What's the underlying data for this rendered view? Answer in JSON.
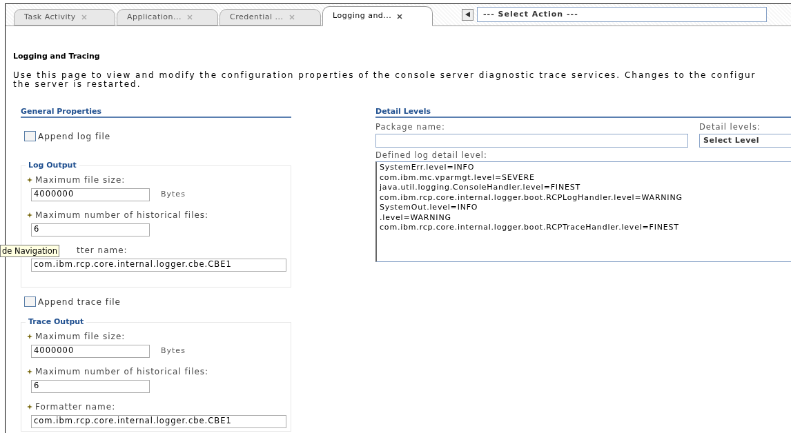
{
  "tabs": [
    {
      "label": "Task Activity",
      "selected": false
    },
    {
      "label": "Application...",
      "selected": false
    },
    {
      "label": "Credential ...",
      "selected": false
    },
    {
      "label": "Logging and...",
      "selected": true
    }
  ],
  "action_select": {
    "value": "--- Select Action ---"
  },
  "page_title": "Logging and Tracing",
  "description_lines": [
    "Use this page to view and modify the configuration properties of the console server diagnostic trace services. Changes to the configur",
    "the server is restarted."
  ],
  "general_properties": {
    "heading": "General Properties",
    "groups": [
      {
        "checkbox": {
          "label": "Append log file",
          "checked": false
        },
        "legend": "Log Output",
        "fields": [
          {
            "label": "Maximum file size:",
            "required": true,
            "value": "4000000",
            "unit": "Bytes"
          },
          {
            "label": "Maximum number of historical files:",
            "required": true,
            "value": "6"
          },
          {
            "label": "tter name:",
            "value": "com.ibm.rcp.core.internal.logger.cbe.CBE1"
          }
        ]
      },
      {
        "checkbox": {
          "label": "Append trace file",
          "checked": false
        },
        "legend": "Trace Output",
        "fields": [
          {
            "label": "Maximum file size:",
            "required": true,
            "value": "4000000",
            "unit": "Bytes"
          },
          {
            "label": "Maximum number of historical files:",
            "required": true,
            "value": "6"
          },
          {
            "label": "Formatter name:",
            "required": true,
            "value": "com.ibm.rcp.core.internal.logger.cbe.CBE1"
          }
        ]
      }
    ]
  },
  "detail_levels": {
    "heading": "Detail Levels",
    "package_name": {
      "label": "Package name:"
    },
    "level_select": {
      "label": "Detail levels:",
      "value": "Select Level"
    },
    "defined": {
      "label": "Defined log detail level:",
      "lines": [
        "SystemErr.level=INFO",
        "com.ibm.mc.vparmgt.level=SEVERE",
        "java.util.logging.ConsoleHandler.level=FINEST",
        "com.ibm.rcp.core.internal.logger.boot.RCPLogHandler.level=WARNING",
        "SystemOut.level=INFO",
        ".level=WARNING",
        "com.ibm.rcp.core.internal.logger.boot.RCPTraceHandler.level=FINEST"
      ]
    }
  },
  "tooltip": {
    "text": "de Navigation"
  }
}
